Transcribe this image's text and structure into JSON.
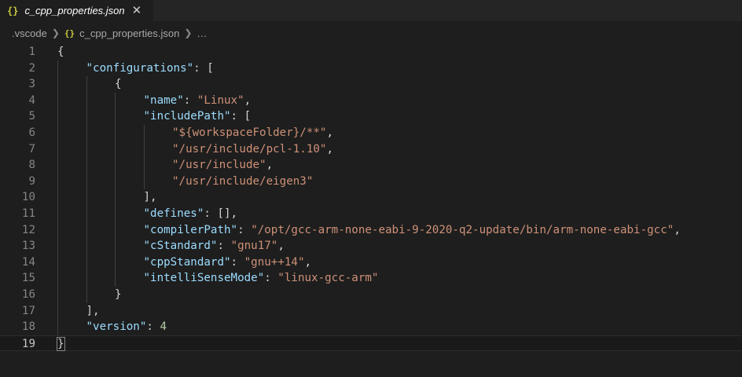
{
  "tab": {
    "icon": "{}",
    "label": "c_cpp_properties.json",
    "close": "✕"
  },
  "breadcrumb": {
    "folder": ".vscode",
    "file_icon": "{}",
    "file": "c_cpp_properties.json",
    "ellipsis": "…"
  },
  "editor": {
    "current_line": 19,
    "lines": [
      {
        "num": "1",
        "indent": 0,
        "tokens": [
          [
            "p",
            "{"
          ]
        ]
      },
      {
        "num": "2",
        "indent": 1,
        "tokens": [
          [
            "k",
            "\"configurations\""
          ],
          [
            "p",
            ": ["
          ]
        ]
      },
      {
        "num": "3",
        "indent": 2,
        "tokens": [
          [
            "p",
            "{"
          ]
        ]
      },
      {
        "num": "4",
        "indent": 3,
        "tokens": [
          [
            "k",
            "\"name\""
          ],
          [
            "p",
            ": "
          ],
          [
            "s",
            "\"Linux\""
          ],
          [
            "p",
            ","
          ]
        ]
      },
      {
        "num": "5",
        "indent": 3,
        "tokens": [
          [
            "k",
            "\"includePath\""
          ],
          [
            "p",
            ": ["
          ]
        ]
      },
      {
        "num": "6",
        "indent": 4,
        "tokens": [
          [
            "s",
            "\"${workspaceFolder}/**\""
          ],
          [
            "p",
            ","
          ]
        ]
      },
      {
        "num": "7",
        "indent": 4,
        "tokens": [
          [
            "s",
            "\"/usr/include/pcl-1.10\""
          ],
          [
            "p",
            ","
          ]
        ]
      },
      {
        "num": "8",
        "indent": 4,
        "tokens": [
          [
            "s",
            "\"/usr/include\""
          ],
          [
            "p",
            ","
          ]
        ]
      },
      {
        "num": "9",
        "indent": 4,
        "tokens": [
          [
            "s",
            "\"/usr/include/eigen3\""
          ]
        ]
      },
      {
        "num": "10",
        "indent": 3,
        "tokens": [
          [
            "p",
            "],"
          ]
        ]
      },
      {
        "num": "11",
        "indent": 3,
        "tokens": [
          [
            "k",
            "\"defines\""
          ],
          [
            "p",
            ": [],"
          ]
        ]
      },
      {
        "num": "12",
        "indent": 3,
        "tokens": [
          [
            "k",
            "\"compilerPath\""
          ],
          [
            "p",
            ": "
          ],
          [
            "s",
            "\"/opt/gcc-arm-none-eabi-9-2020-q2-update/bin/arm-none-eabi-gcc\""
          ],
          [
            "p",
            ","
          ]
        ]
      },
      {
        "num": "13",
        "indent": 3,
        "tokens": [
          [
            "k",
            "\"cStandard\""
          ],
          [
            "p",
            ": "
          ],
          [
            "s",
            "\"gnu17\""
          ],
          [
            "p",
            ","
          ]
        ]
      },
      {
        "num": "14",
        "indent": 3,
        "tokens": [
          [
            "k",
            "\"cppStandard\""
          ],
          [
            "p",
            ": "
          ],
          [
            "s",
            "\"gnu++14\""
          ],
          [
            "p",
            ","
          ]
        ]
      },
      {
        "num": "15",
        "indent": 3,
        "tokens": [
          [
            "k",
            "\"intelliSenseMode\""
          ],
          [
            "p",
            ": "
          ],
          [
            "s",
            "\"linux-gcc-arm\""
          ]
        ]
      },
      {
        "num": "16",
        "indent": 2,
        "tokens": [
          [
            "p",
            "}"
          ]
        ]
      },
      {
        "num": "17",
        "indent": 1,
        "tokens": [
          [
            "p",
            "],"
          ]
        ]
      },
      {
        "num": "18",
        "indent": 1,
        "tokens": [
          [
            "k",
            "\"version\""
          ],
          [
            "p",
            ": "
          ],
          [
            "n",
            "4"
          ]
        ]
      },
      {
        "num": "19",
        "indent": 0,
        "tokens": [
          [
            "p",
            "}"
          ]
        ]
      }
    ]
  }
}
